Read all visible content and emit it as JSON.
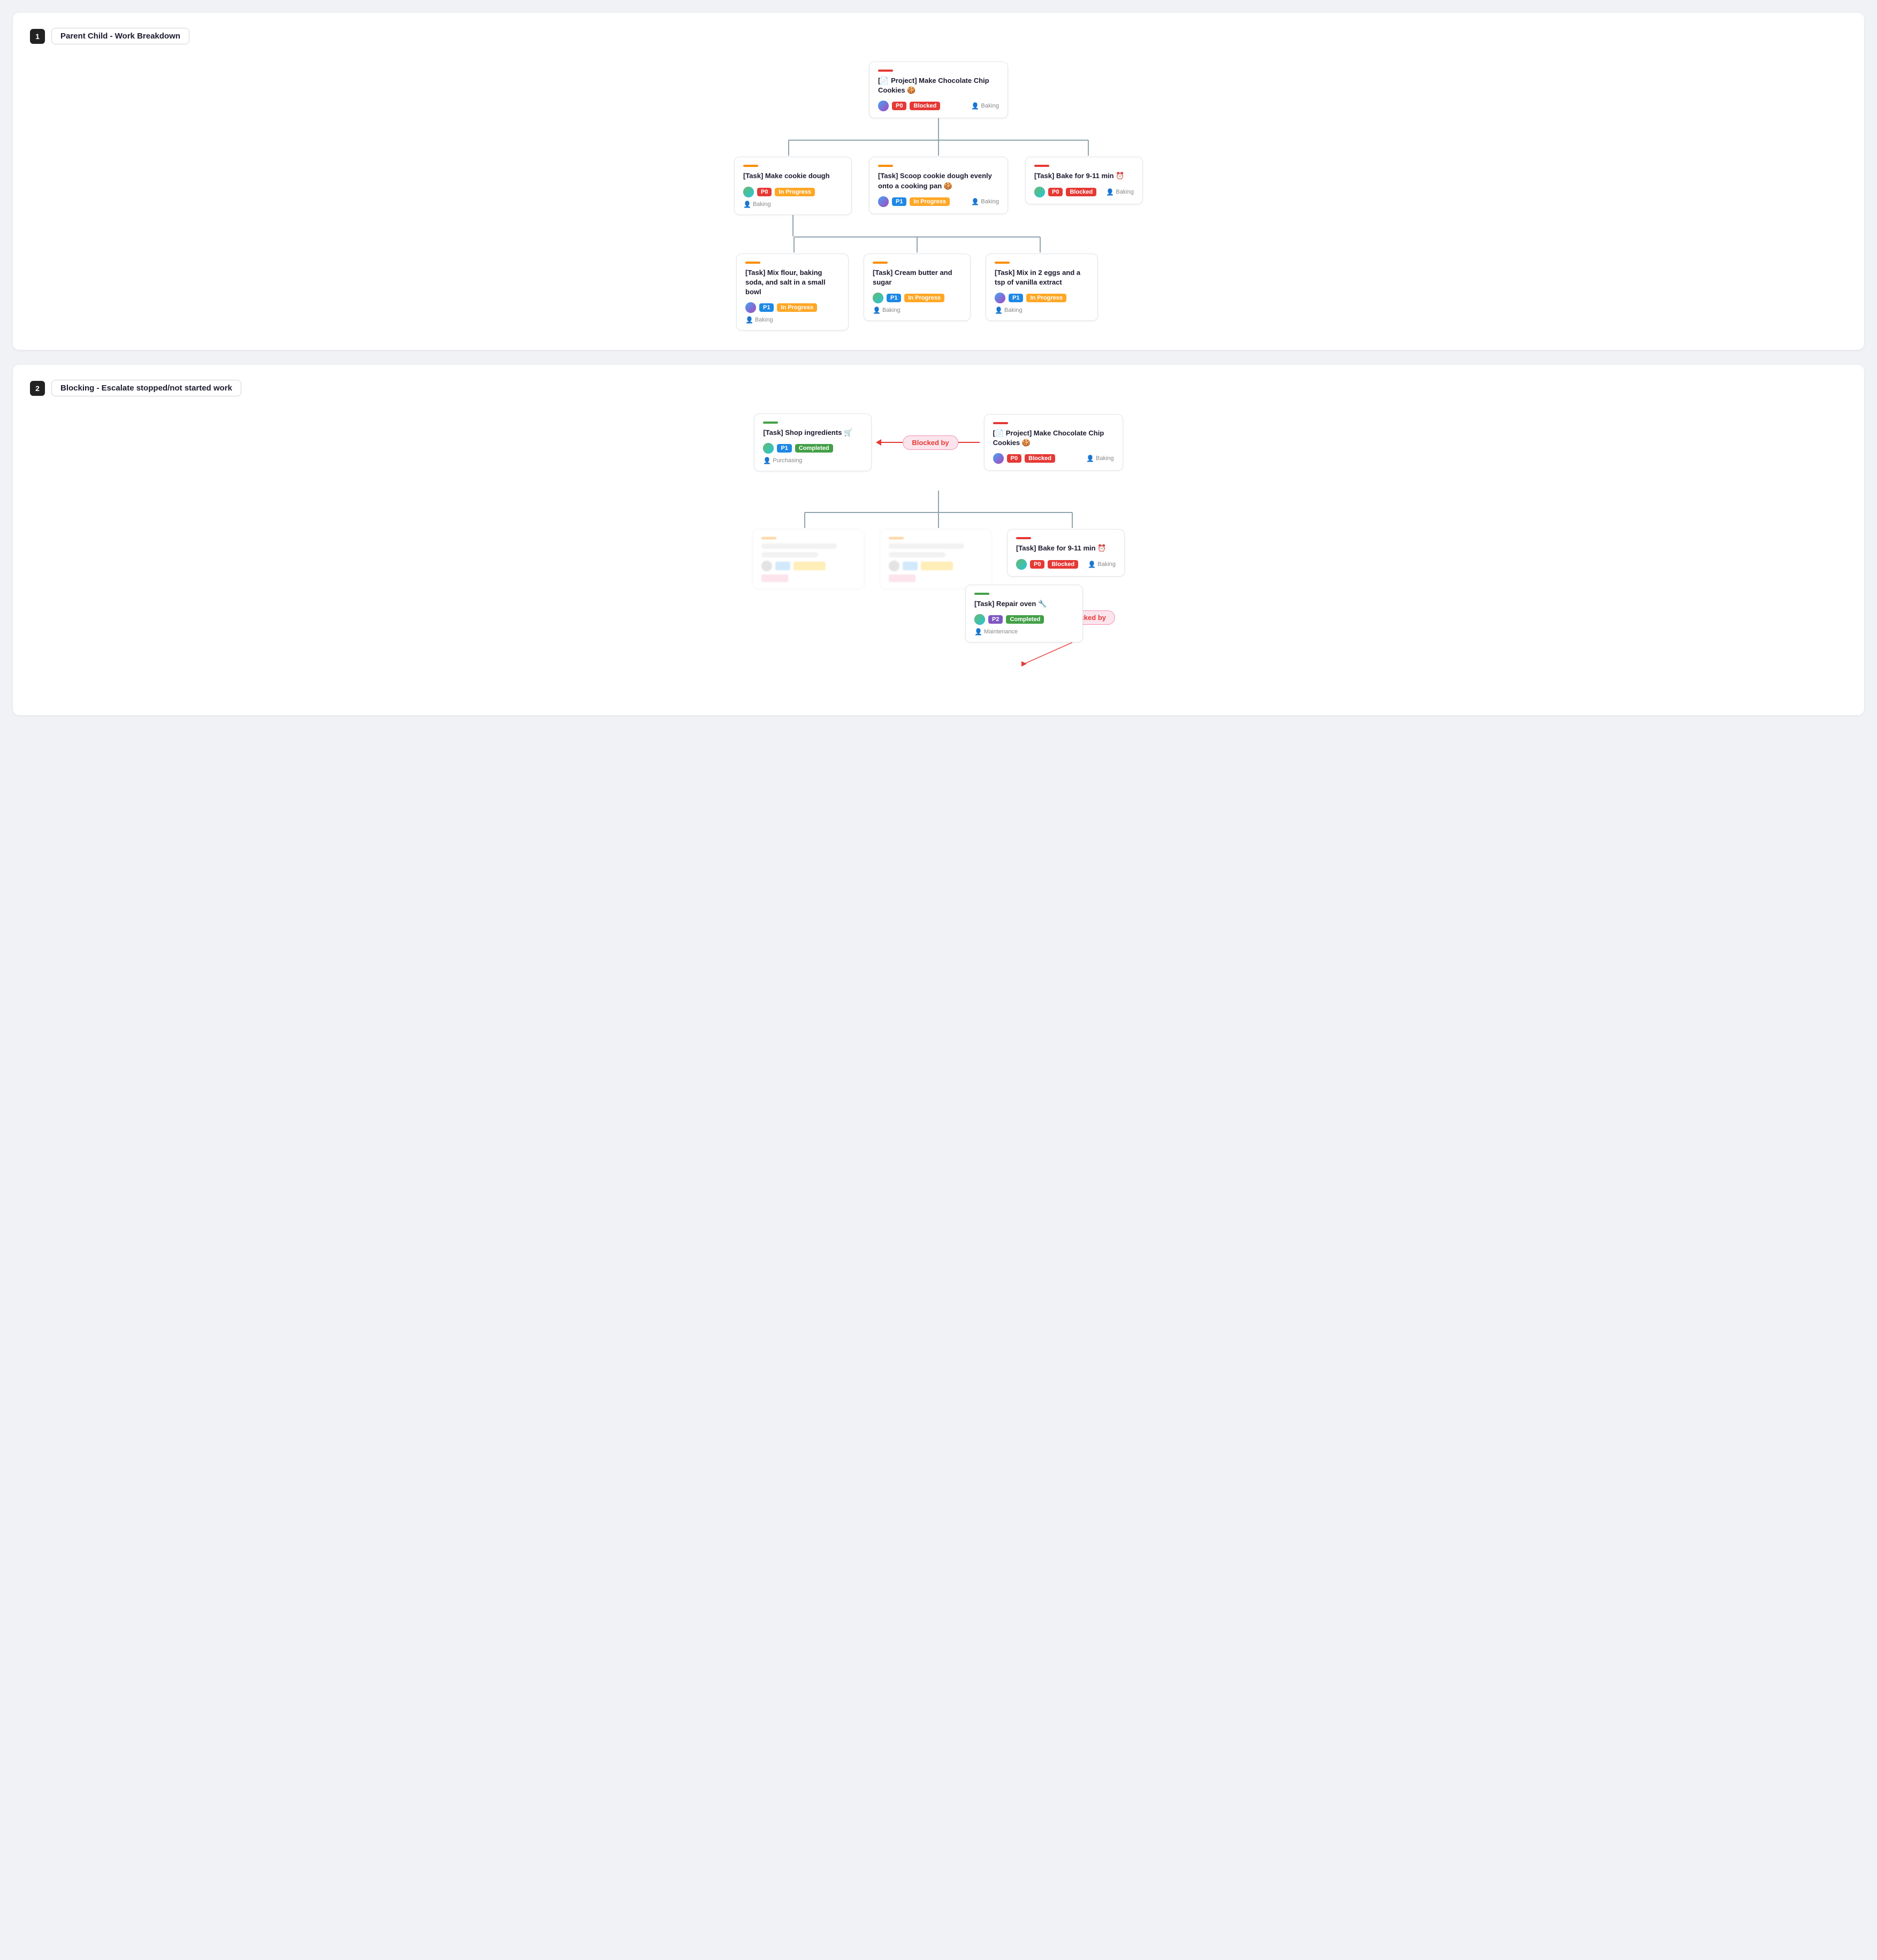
{
  "section1": {
    "num": "1",
    "title": "Parent Child - Work Breakdown",
    "root": {
      "accent": "accent-red",
      "title": "[📄 Project] Make Chocolate Chip Cookies 🍪",
      "avatar": "avatar1",
      "badge_p": "P0",
      "badge_p_class": "badge-p0",
      "badge_status": "Blocked",
      "badge_status_class": "badge-blocked",
      "tag": "Baking"
    },
    "level1": [
      {
        "accent": "accent-orange",
        "title": "[Task] Make cookie dough",
        "badge_p": "P0",
        "badge_p_class": "badge-p0",
        "badge_status": "In Progress",
        "badge_status_class": "badge-inprogress",
        "tag": "Baking",
        "has_children": true
      },
      {
        "accent": "accent-orange",
        "title": "[Task] Scoop cookie dough evenly onto a cooking pan 🍪",
        "badge_p": "P1",
        "badge_p_class": "badge-p1",
        "badge_status": "In Progress",
        "badge_status_class": "badge-inprogress",
        "tag": "Baking",
        "has_children": false
      },
      {
        "accent": "accent-red",
        "title": "[Task] Bake for 9-11 min ⏰",
        "badge_p": "P0",
        "badge_p_class": "badge-p0",
        "badge_status": "Blocked",
        "badge_status_class": "badge-blocked",
        "tag": "Baking",
        "has_children": false
      }
    ],
    "level2": [
      {
        "accent": "accent-orange",
        "title": "[Task] Mix flour, baking soda, and salt in a small bowl",
        "badge_p": "P1",
        "badge_p_class": "badge-p1",
        "badge_status": "In Progress",
        "badge_status_class": "badge-inprogress",
        "tag": "Baking"
      },
      {
        "accent": "accent-orange",
        "title": "[Task] Cream butter and sugar",
        "badge_p": "P1",
        "badge_p_class": "badge-p1",
        "badge_status": "In Progress",
        "badge_status_class": "badge-inprogress",
        "tag": "Baking"
      },
      {
        "accent": "accent-orange",
        "title": "[Task] Mix in 2 eggs and a tsp of vanilla extract",
        "badge_p": "P1",
        "badge_p_class": "badge-p1",
        "badge_status": "In Progress",
        "badge_status_class": "badge-inprogress",
        "tag": "Baking"
      }
    ]
  },
  "section2": {
    "num": "2",
    "title": "Blocking - Escalate stopped/not started work",
    "blocked_node": {
      "accent": "accent-green",
      "title": "[Task] Shop ingredients 🛒",
      "badge_p": "P1",
      "badge_p_class": "badge-p1",
      "badge_status": "Completed",
      "badge_status_class": "badge-completed",
      "tag": "Purchasing"
    },
    "blocked_by_label": "Blocked by",
    "root": {
      "accent": "accent-red",
      "title": "[📄 Project] Make Chocolate Chip Cookies 🍪",
      "badge_p": "P0",
      "badge_p_class": "badge-p0",
      "badge_status": "Blocked",
      "badge_status_class": "badge-blocked",
      "tag": "Baking"
    },
    "level1_blurred": [
      {
        "accent": "accent-orange",
        "blurred": true
      },
      {
        "accent": "accent-orange",
        "blurred": true
      }
    ],
    "level1_right": {
      "accent": "accent-red",
      "title": "[Task] Bake for 9-11 min ⏰",
      "badge_p": "P0",
      "badge_p_class": "badge-p0",
      "badge_status": "Blocked",
      "badge_status_class": "badge-blocked",
      "tag": "Baking"
    },
    "blocked_by_label2": "Blocked by",
    "repair_node": {
      "accent": "accent-green",
      "title": "[Task] Repair oven 🔧",
      "badge_p": "P2",
      "badge_p_class": "badge-p2",
      "badge_status": "Completed",
      "badge_status_class": "badge-completed",
      "tag": "Maintenance"
    }
  }
}
